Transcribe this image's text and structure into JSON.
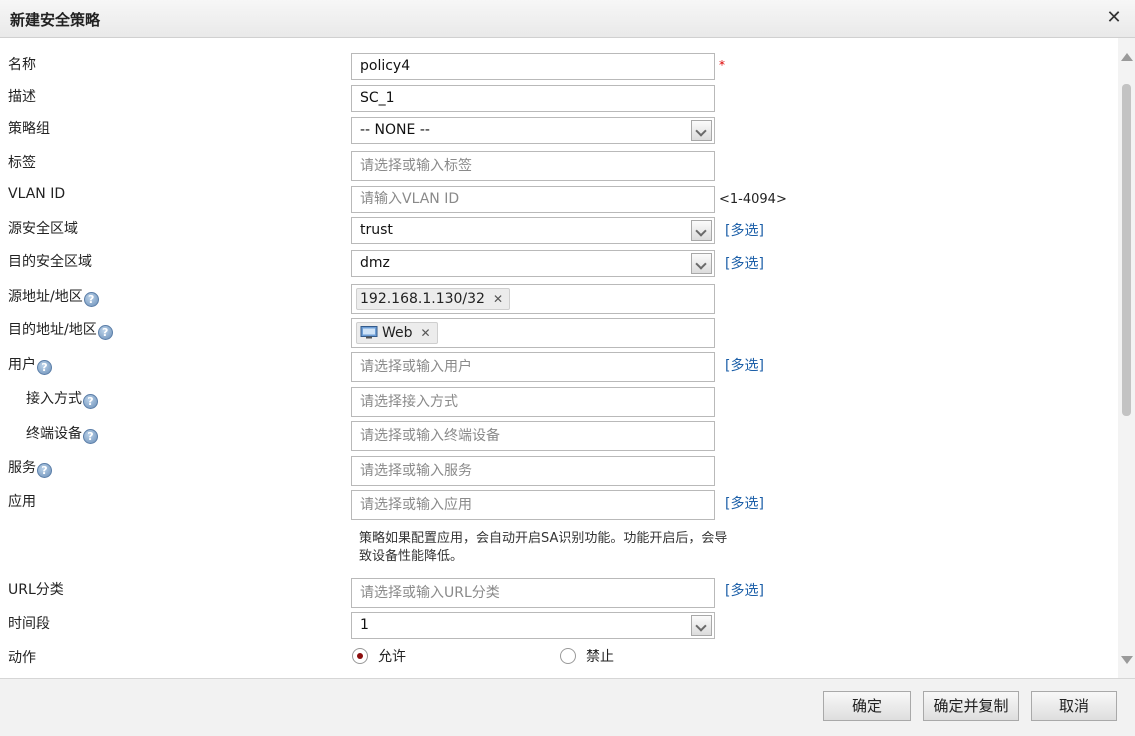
{
  "dialog": {
    "title": "新建安全策略",
    "close_symbol": "✕"
  },
  "form": {
    "name": {
      "label": "名称",
      "value": "policy4",
      "required_mark": "*"
    },
    "description": {
      "label": "描述",
      "value": "SC_1"
    },
    "policy_group": {
      "label": "策略组",
      "value": "-- NONE --"
    },
    "tags": {
      "label": "标签",
      "placeholder": "请选择或输入标签"
    },
    "vlan": {
      "label": "VLAN ID",
      "placeholder": "请输入VLAN ID",
      "hint": "<1-4094>"
    },
    "src_zone": {
      "label": "源安全区域",
      "value": "trust",
      "multi": "[多选]"
    },
    "dst_zone": {
      "label": "目的安全区域",
      "value": "dmz",
      "multi": "[多选]"
    },
    "src_addr": {
      "label": "源地址/地区",
      "tag": "192.168.1.130/32"
    },
    "dst_addr": {
      "label": "目的地址/地区",
      "tag": "Web"
    },
    "user": {
      "label": "用户",
      "placeholder": "请选择或输入用户",
      "multi": "[多选]"
    },
    "access_mode": {
      "label": "接入方式",
      "placeholder": "请选择接入方式"
    },
    "terminal": {
      "label": "终端设备",
      "placeholder": "请选择或输入终端设备"
    },
    "service": {
      "label": "服务",
      "placeholder": "请选择或输入服务"
    },
    "application": {
      "label": "应用",
      "placeholder": "请选择或输入应用",
      "multi": "[多选]",
      "note": "策略如果配置应用，会自动开启SA识别功能。功能开启后，会导致设备性能降低。"
    },
    "url_category": {
      "label": "URL分类",
      "placeholder": "请选择或输入URL分类",
      "multi": "[多选]"
    },
    "time_range": {
      "label": "时间段",
      "value": "1"
    },
    "action": {
      "label": "动作",
      "allow": "允许",
      "deny": "禁止",
      "selected": "allow"
    }
  },
  "icons": {
    "help": "?",
    "tag_remove": "✕"
  },
  "footer": {
    "ok": "确定",
    "ok_copy": "确定并复制",
    "cancel": "取消"
  },
  "colors": {
    "link": "#1c5fa8",
    "required": "#dd0000",
    "radio_checked": "#8b0d0d"
  }
}
